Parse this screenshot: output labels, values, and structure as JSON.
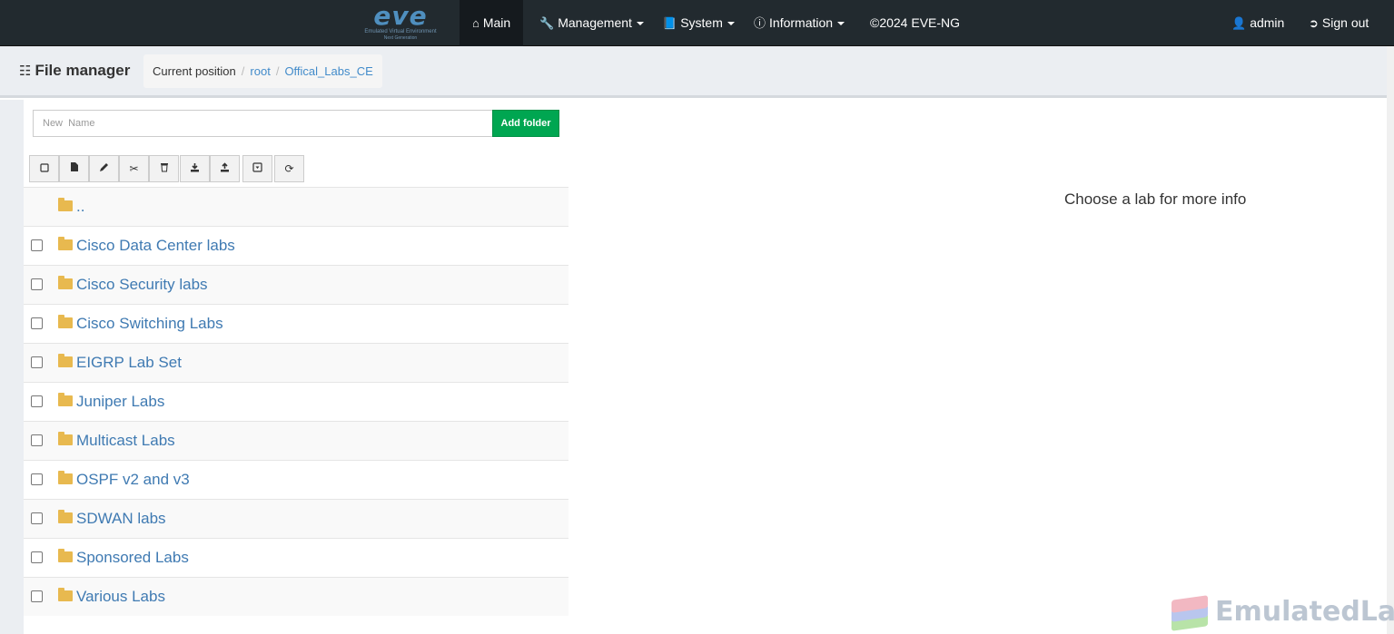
{
  "navbar": {
    "logo_text": "eve",
    "logo_sub1": "Emulated Virtual Environment",
    "logo_sub2": "Next Generation",
    "items": [
      {
        "label": "Main",
        "icon": "home-icon"
      },
      {
        "label": "Management",
        "icon": "wrench-icon"
      },
      {
        "label": "System",
        "icon": "book-icon"
      },
      {
        "label": "Information",
        "icon": "info-circle-icon"
      },
      {
        "label": "©2024 EVE-NG"
      }
    ],
    "user": {
      "label": "admin",
      "icon": "user-icon"
    },
    "signout": {
      "label": "Sign out",
      "icon": "sign-out-icon"
    }
  },
  "header": {
    "title": "File manager",
    "title_icon": "sitemap-icon",
    "breadcrumb": {
      "prefix": "Current position",
      "items": [
        "root",
        "Offical_Labs_CE"
      ]
    }
  },
  "folder_form": {
    "placeholder": "New  Name",
    "value": "",
    "add_label": "Add folder",
    "add_color": "#00a651"
  },
  "toolbar": {
    "buttons": [
      {
        "name": "select-all-icon"
      },
      {
        "name": "new-file-icon"
      },
      {
        "name": "edit-icon"
      },
      {
        "name": "cut-icon"
      },
      {
        "name": "delete-icon"
      },
      {
        "name": "download-icon"
      },
      {
        "name": "upload-icon"
      },
      {
        "name": "archive-icon"
      },
      {
        "name": "refresh-icon"
      }
    ]
  },
  "files": {
    "parent": "..",
    "folders": [
      "Cisco Data Center labs",
      "Cisco Security labs",
      "Cisco Switching Labs",
      "EIGRP Lab Set",
      "Juniper Labs",
      "Multicast Labs",
      "OSPF v2 and v3",
      "SDWAN labs",
      "Sponsored Labs",
      "Various Labs"
    ]
  },
  "info_panel": {
    "message": "Choose a lab for more info"
  },
  "watermark": {
    "text": "EmulatedLab"
  },
  "colors": {
    "navbar": "#222a2f",
    "link": "#3f7ab2",
    "folder": "#e8b94f"
  }
}
